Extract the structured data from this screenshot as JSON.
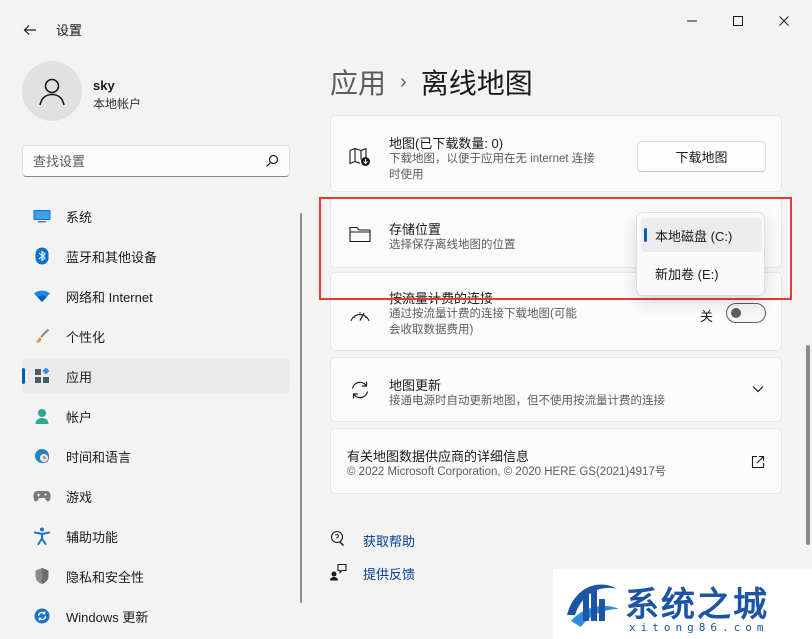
{
  "window": {
    "title": "设置",
    "controls": {
      "minimize": "minimize",
      "maximize": "maximize",
      "close": "close"
    }
  },
  "profile": {
    "name": "sky",
    "account_type": "本地帐户"
  },
  "search": {
    "placeholder": "查找设置"
  },
  "sidebar": {
    "items": [
      {
        "label": "系统",
        "icon": "monitor-icon",
        "color": "#0078d4"
      },
      {
        "label": "蓝牙和其他设备",
        "icon": "bluetooth-icon",
        "color": "#0078d4"
      },
      {
        "label": "网络和 Internet",
        "icon": "wifi-icon",
        "color": "#0078d4"
      },
      {
        "label": "个性化",
        "icon": "brush-icon",
        "color": "#d88432"
      },
      {
        "label": "应用",
        "icon": "apps-icon",
        "color": "#4a5561",
        "active": true
      },
      {
        "label": "帐户",
        "icon": "account-icon",
        "color": "#2ea88e"
      },
      {
        "label": "时间和语言",
        "icon": "clock-globe-icon",
        "color": "#1e88c7"
      },
      {
        "label": "游戏",
        "icon": "gamepad-icon",
        "color": "#6b6b6b"
      },
      {
        "label": "辅助功能",
        "icon": "accessibility-icon",
        "color": "#1a73c7"
      },
      {
        "label": "隐私和安全性",
        "icon": "shield-icon",
        "color": "#7a7a7a"
      },
      {
        "label": "Windows 更新",
        "icon": "update-icon",
        "color": "#1a73c7"
      }
    ]
  },
  "breadcrumb": {
    "parent": "应用",
    "separator": "›",
    "current": "离线地图"
  },
  "maps_card": {
    "title": "地图(已下载数量: 0)",
    "desc_line1": "下载地图，以便于应用在无 internet 连接",
    "desc_line2": "时使用",
    "button": "下载地图"
  },
  "storage_card": {
    "title": "存储位置",
    "desc": "选择保存离线地图的位置"
  },
  "storage_dropdown": {
    "options": [
      {
        "label": "本地磁盘 (C:)",
        "selected": true
      },
      {
        "label": "新加卷 (E:)",
        "selected": false
      }
    ]
  },
  "metered_card": {
    "title": "按流量计费的连接",
    "desc_line1": "通过按流量计费的连接下载地图(可能",
    "desc_line2": "会收取数据费用)",
    "toggle_label": "关",
    "toggle_on": false
  },
  "update_card": {
    "title": "地图更新",
    "desc": "接通电源时自动更新地图，但不使用按流量计费的连接"
  },
  "provider_card": {
    "title": "有关地图数据供应商的详细信息",
    "desc": "© 2022 Microsoft Corporation, © 2020 HERE GS(2021)4917号"
  },
  "links": {
    "help": "获取帮助",
    "feedback": "提供反馈"
  },
  "watermark": {
    "title": "系统之城",
    "subtitle": "xitong86.com"
  },
  "colors": {
    "accent": "#005fb8",
    "highlight": "#e23b3b",
    "link": "#003e92"
  }
}
